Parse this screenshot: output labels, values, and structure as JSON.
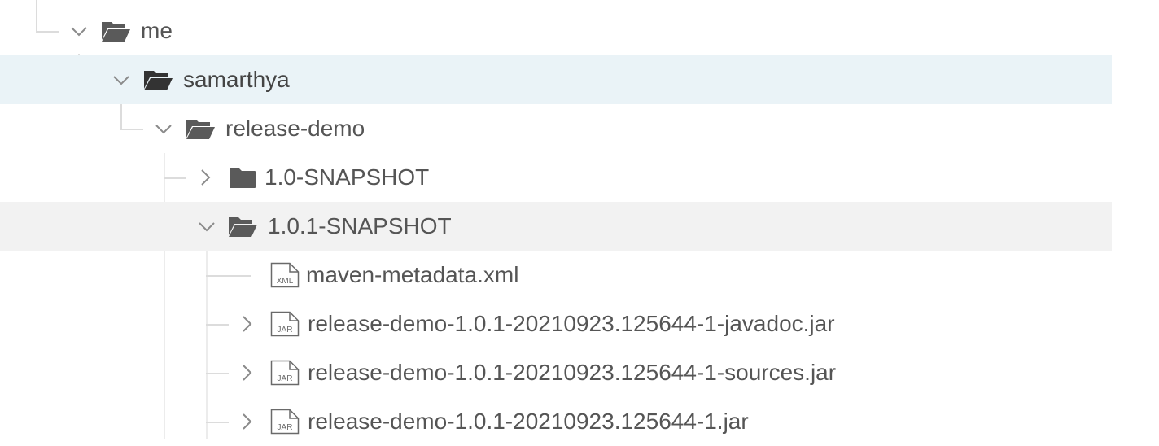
{
  "tree": {
    "nodes": [
      {
        "label": "me",
        "icon": "folder-open-icon",
        "toggle": "chevron-down-icon",
        "state": "expanded"
      },
      {
        "label": "samarthya",
        "icon": "folder-open-icon",
        "toggle": "chevron-down-icon",
        "state": "expanded-selected"
      },
      {
        "label": "release-demo",
        "icon": "folder-open-icon",
        "toggle": "chevron-down-icon",
        "state": "expanded"
      },
      {
        "label": "1.0-SNAPSHOT",
        "icon": "folder-closed-icon",
        "toggle": "chevron-right-icon",
        "state": "collapsed"
      },
      {
        "label": "1.0.1-SNAPSHOT",
        "icon": "folder-open-icon",
        "toggle": "chevron-down-icon",
        "state": "expanded-hover"
      },
      {
        "label": "maven-metadata.xml",
        "icon": "xml-file-icon",
        "icon_text": "XML",
        "toggle": "none",
        "state": "leaf"
      },
      {
        "label": "release-demo-1.0.1-20210923.125644-1-javadoc.jar",
        "icon": "jar-file-icon",
        "icon_text": "JAR",
        "toggle": "chevron-right-icon",
        "state": "collapsed"
      },
      {
        "label": "release-demo-1.0.1-20210923.125644-1-sources.jar",
        "icon": "jar-file-icon",
        "icon_text": "JAR",
        "toggle": "chevron-right-icon",
        "state": "collapsed"
      },
      {
        "label": "release-demo-1.0.1-20210923.125644-1.jar",
        "icon": "jar-file-icon",
        "icon_text": "JAR",
        "toggle": "chevron-right-icon",
        "state": "collapsed"
      }
    ]
  },
  "colors": {
    "text": "#555555",
    "icon": "#5a5a5a",
    "chevron": "#8a8a8a",
    "guide": "#dcdcdc",
    "selected_bg": "#eaf3f7",
    "hover_bg": "#f2f2f2"
  }
}
